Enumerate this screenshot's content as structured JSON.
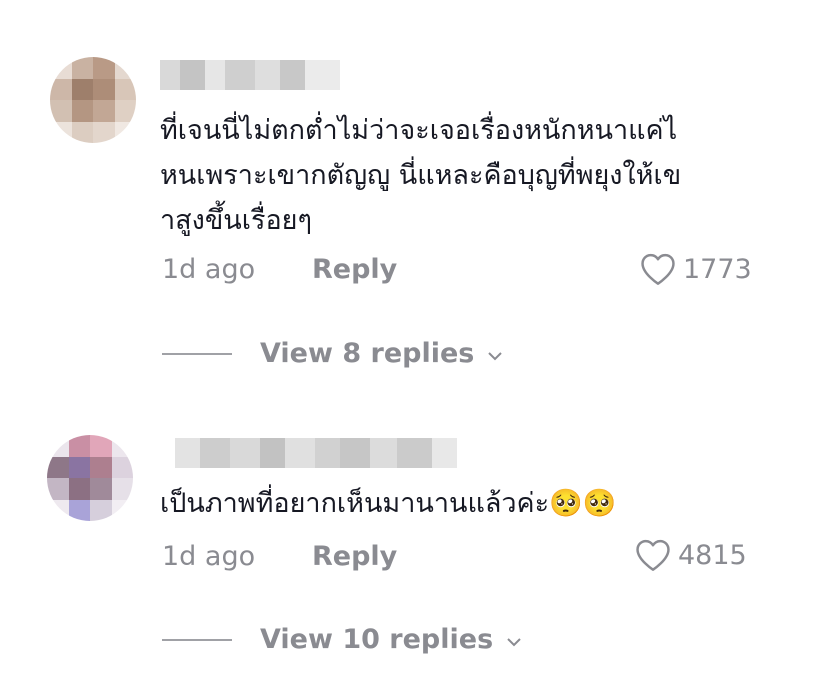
{
  "comments": [
    {
      "text_lines": [
        "ที่เจนนี่ไม่ตกต่ำไม่ว่าจะเจอเรื่องหนักหนาแค่ไ",
        "หนเพราะเขากตัญญู นี่แหละคือบุญที่พยุงให้เข",
        "าสูงขึ้นเรื่อยๆ"
      ],
      "time": "1d ago",
      "reply_label": "Reply",
      "likes": "1773",
      "view_replies": "View 8 replies"
    },
    {
      "text_lines": [
        "เป็นภาพที่อยากเห็นมานานแล้วค่ะ🥺🥺"
      ],
      "time": "1d ago",
      "reply_label": "Reply",
      "likes": "4815",
      "view_replies": "View 10 replies"
    }
  ],
  "icons": {
    "heart": "heart-outline-icon",
    "chevron": "chevron-down-icon"
  },
  "colors": {
    "text": "#161823",
    "muted": "#8a8b91"
  }
}
